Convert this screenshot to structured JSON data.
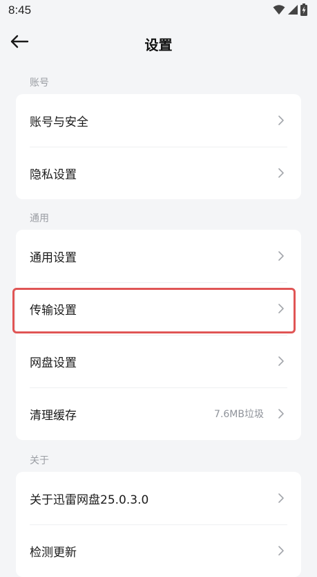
{
  "status_bar": {
    "time": "8:45",
    "icons": [
      "wifi-icon",
      "cellular-signal-icon",
      "battery-charging-icon"
    ]
  },
  "header": {
    "title": "设置",
    "back_icon": "arrow-left-icon"
  },
  "sections": [
    {
      "label": "账号",
      "items": [
        {
          "label": "账号与安全",
          "value": ""
        },
        {
          "label": "隐私设置",
          "value": ""
        }
      ]
    },
    {
      "label": "通用",
      "items": [
        {
          "label": "通用设置",
          "value": ""
        },
        {
          "label": "传输设置",
          "value": ""
        },
        {
          "label": "网盘设置",
          "value": ""
        },
        {
          "label": "清理缓存",
          "value": "7.6MB垃圾"
        }
      ]
    },
    {
      "label": "关于",
      "items": [
        {
          "label": "关于迅雷网盘25.0.3.0",
          "value": ""
        },
        {
          "label": "检测更新",
          "value": ""
        }
      ]
    }
  ],
  "colors": {
    "background": "#f4f5f7",
    "card": "#ffffff",
    "highlight": "#e05555",
    "secondary_text": "#9a9da3"
  }
}
